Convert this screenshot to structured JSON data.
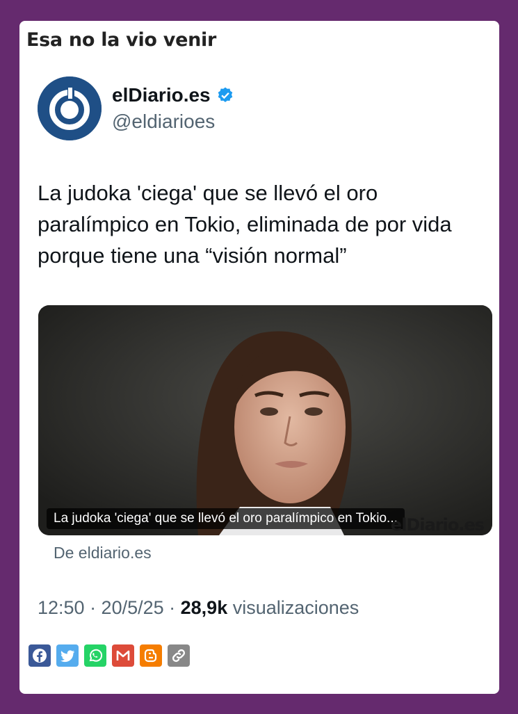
{
  "post": {
    "title": "Esa no la vio venir"
  },
  "tweet": {
    "account_name": "elDiario.es",
    "handle": "@eldiarioes",
    "verified": true,
    "text": "La judoka 'ciega' que se llevó el oro paralímpico en Tokio, eliminada de por vida porque tiene una “visión normal”",
    "media": {
      "caption": "La judoka 'ciega' que se llevó el oro paralímpico en Tokio...",
      "logo_text": "elDiario.es"
    },
    "source": "De eldiario.es",
    "time": "12:50 · 20/5/25 · ",
    "views_count": "28,9k",
    "views_label": " visualizaciones"
  },
  "share": [
    {
      "name": "facebook",
      "icon": "facebook-icon",
      "color": "#3b5998"
    },
    {
      "name": "twitter",
      "icon": "twitter-icon",
      "color": "#55acee"
    },
    {
      "name": "whatsapp",
      "icon": "whatsapp-icon",
      "color": "#25d366"
    },
    {
      "name": "gmail",
      "icon": "gmail-icon",
      "color": "#dd4b39"
    },
    {
      "name": "blogger",
      "icon": "blogger-icon",
      "color": "#f57d00"
    },
    {
      "name": "copy-link",
      "icon": "link-icon",
      "color": "#888888"
    }
  ],
  "colors": {
    "page_bg": "#652a6e",
    "brand_blue": "#1f4f86",
    "verified": "#1d9bf0"
  }
}
